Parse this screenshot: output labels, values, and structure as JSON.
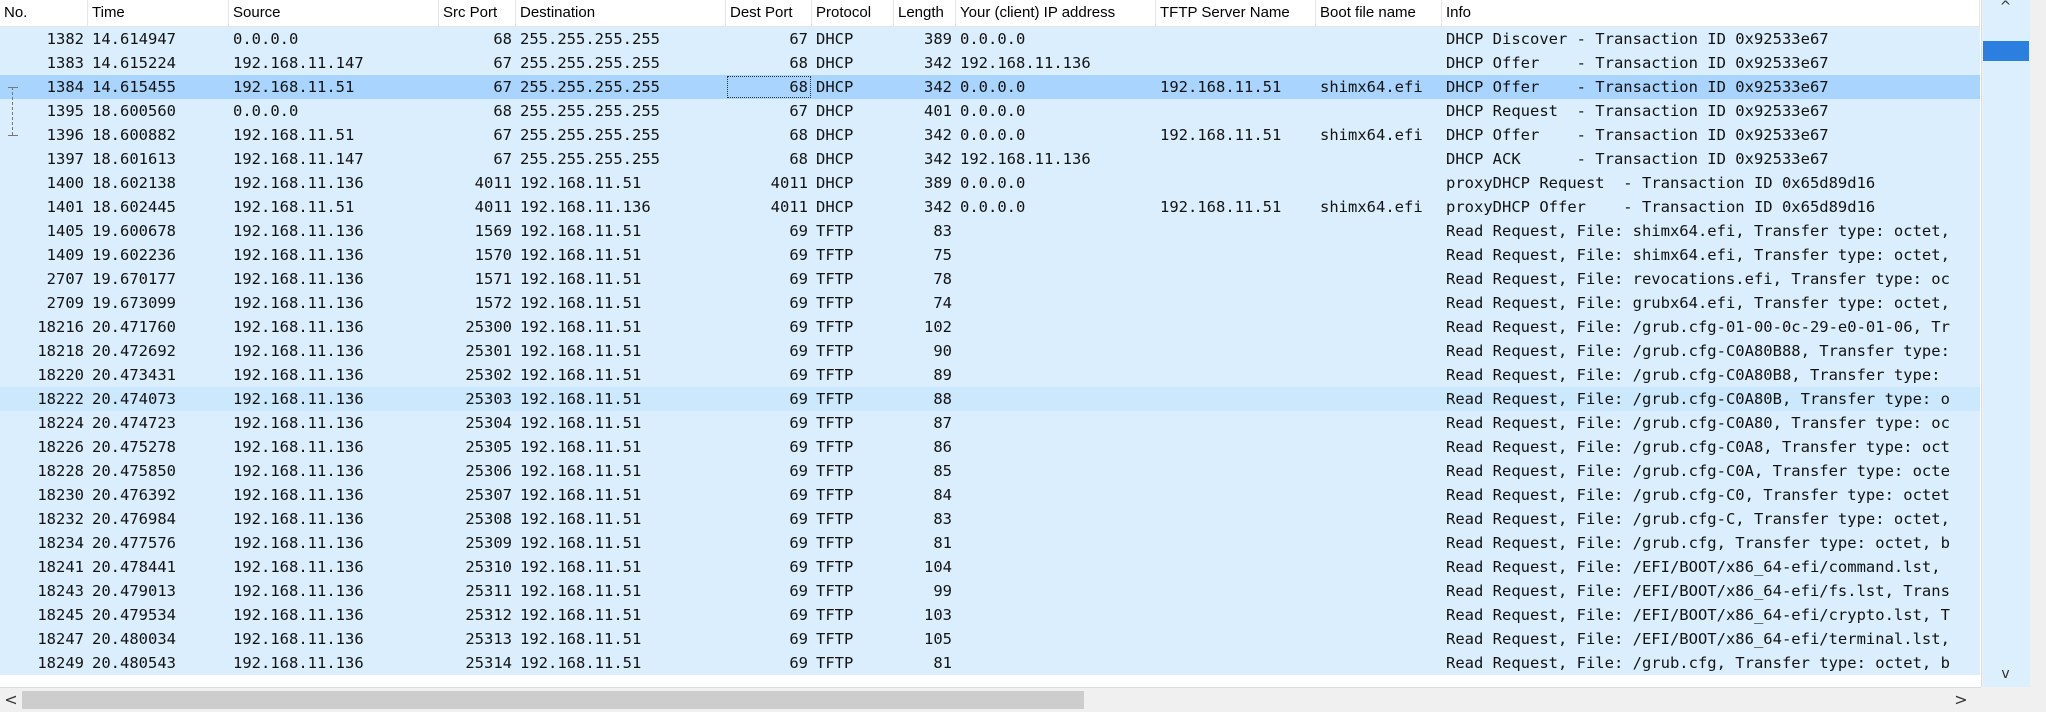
{
  "columns": [
    {
      "key": "no",
      "label": "No."
    },
    {
      "key": "time",
      "label": "Time"
    },
    {
      "key": "source",
      "label": "Source"
    },
    {
      "key": "src_port",
      "label": "Src Port"
    },
    {
      "key": "destination",
      "label": "Destination"
    },
    {
      "key": "dest_port",
      "label": "Dest Port"
    },
    {
      "key": "protocol",
      "label": "Protocol"
    },
    {
      "key": "length",
      "label": "Length"
    },
    {
      "key": "client_ip",
      "label": "Your (client) IP address"
    },
    {
      "key": "tftp_server",
      "label": "TFTP Server Name"
    },
    {
      "key": "boot_file",
      "label": "Boot file name"
    },
    {
      "key": "info",
      "label": "Info"
    }
  ],
  "packets": [
    {
      "no": "1382",
      "time": "14.614947",
      "source": "0.0.0.0",
      "src_port": "68",
      "destination": "255.255.255.255",
      "dest_port": "67",
      "protocol": "DHCP",
      "length": "389",
      "client_ip": "0.0.0.0",
      "tftp_server": "",
      "boot_file": "",
      "info": "DHCP Discover - Transaction ID 0x92533e67"
    },
    {
      "no": "1383",
      "time": "14.615224",
      "source": "192.168.11.147",
      "src_port": "67",
      "destination": "255.255.255.255",
      "dest_port": "68",
      "protocol": "DHCP",
      "length": "342",
      "client_ip": "192.168.11.136",
      "tftp_server": "",
      "boot_file": "",
      "info": "DHCP Offer    - Transaction ID 0x92533e67"
    },
    {
      "no": "1384",
      "time": "14.615455",
      "source": "192.168.11.51",
      "src_port": "67",
      "destination": "255.255.255.255",
      "dest_port": "68",
      "protocol": "DHCP",
      "length": "342",
      "client_ip": "0.0.0.0",
      "tftp_server": "192.168.11.51",
      "boot_file": "shimx64.efi",
      "info": "DHCP Offer    - Transaction ID 0x92533e67"
    },
    {
      "no": "1395",
      "time": "18.600560",
      "source": "0.0.0.0",
      "src_port": "68",
      "destination": "255.255.255.255",
      "dest_port": "67",
      "protocol": "DHCP",
      "length": "401",
      "client_ip": "0.0.0.0",
      "tftp_server": "",
      "boot_file": "",
      "info": "DHCP Request  - Transaction ID 0x92533e67"
    },
    {
      "no": "1396",
      "time": "18.600882",
      "source": "192.168.11.51",
      "src_port": "67",
      "destination": "255.255.255.255",
      "dest_port": "68",
      "protocol": "DHCP",
      "length": "342",
      "client_ip": "0.0.0.0",
      "tftp_server": "192.168.11.51",
      "boot_file": "shimx64.efi",
      "info": "DHCP Offer    - Transaction ID 0x92533e67"
    },
    {
      "no": "1397",
      "time": "18.601613",
      "source": "192.168.11.147",
      "src_port": "67",
      "destination": "255.255.255.255",
      "dest_port": "68",
      "protocol": "DHCP",
      "length": "342",
      "client_ip": "192.168.11.136",
      "tftp_server": "",
      "boot_file": "",
      "info": "DHCP ACK      - Transaction ID 0x92533e67"
    },
    {
      "no": "1400",
      "time": "18.602138",
      "source": "192.168.11.136",
      "src_port": "4011",
      "destination": "192.168.11.51",
      "dest_port": "4011",
      "protocol": "DHCP",
      "length": "389",
      "client_ip": "0.0.0.0",
      "tftp_server": "",
      "boot_file": "",
      "info": "proxyDHCP Request  - Transaction ID 0x65d89d16"
    },
    {
      "no": "1401",
      "time": "18.602445",
      "source": "192.168.11.51",
      "src_port": "4011",
      "destination": "192.168.11.136",
      "dest_port": "4011",
      "protocol": "DHCP",
      "length": "342",
      "client_ip": "0.0.0.0",
      "tftp_server": "192.168.11.51",
      "boot_file": "shimx64.efi",
      "info": "proxyDHCP Offer    - Transaction ID 0x65d89d16"
    },
    {
      "no": "1405",
      "time": "19.600678",
      "source": "192.168.11.136",
      "src_port": "1569",
      "destination": "192.168.11.51",
      "dest_port": "69",
      "protocol": "TFTP",
      "length": "83",
      "client_ip": "",
      "tftp_server": "",
      "boot_file": "",
      "info": "Read Request, File: shimx64.efi, Transfer type: octet,"
    },
    {
      "no": "1409",
      "time": "19.602236",
      "source": "192.168.11.136",
      "src_port": "1570",
      "destination": "192.168.11.51",
      "dest_port": "69",
      "protocol": "TFTP",
      "length": "75",
      "client_ip": "",
      "tftp_server": "",
      "boot_file": "",
      "info": "Read Request, File: shimx64.efi, Transfer type: octet,"
    },
    {
      "no": "2707",
      "time": "19.670177",
      "source": "192.168.11.136",
      "src_port": "1571",
      "destination": "192.168.11.51",
      "dest_port": "69",
      "protocol": "TFTP",
      "length": "78",
      "client_ip": "",
      "tftp_server": "",
      "boot_file": "",
      "info": "Read Request, File: revocations.efi, Transfer type: oc"
    },
    {
      "no": "2709",
      "time": "19.673099",
      "source": "192.168.11.136",
      "src_port": "1572",
      "destination": "192.168.11.51",
      "dest_port": "69",
      "protocol": "TFTP",
      "length": "74",
      "client_ip": "",
      "tftp_server": "",
      "boot_file": "",
      "info": "Read Request, File: grubx64.efi, Transfer type: octet,"
    },
    {
      "no": "18216",
      "time": "20.471760",
      "source": "192.168.11.136",
      "src_port": "25300",
      "destination": "192.168.11.51",
      "dest_port": "69",
      "protocol": "TFTP",
      "length": "102",
      "client_ip": "",
      "tftp_server": "",
      "boot_file": "",
      "info": "Read Request, File: /grub.cfg-01-00-0c-29-e0-01-06, Tr"
    },
    {
      "no": "18218",
      "time": "20.472692",
      "source": "192.168.11.136",
      "src_port": "25301",
      "destination": "192.168.11.51",
      "dest_port": "69",
      "protocol": "TFTP",
      "length": "90",
      "client_ip": "",
      "tftp_server": "",
      "boot_file": "",
      "info": "Read Request, File: /grub.cfg-C0A80B88, Transfer type:"
    },
    {
      "no": "18220",
      "time": "20.473431",
      "source": "192.168.11.136",
      "src_port": "25302",
      "destination": "192.168.11.51",
      "dest_port": "69",
      "protocol": "TFTP",
      "length": "89",
      "client_ip": "",
      "tftp_server": "",
      "boot_file": "",
      "info": "Read Request, File: /grub.cfg-C0A80B8, Transfer type:"
    },
    {
      "no": "18222",
      "time": "20.474073",
      "source": "192.168.11.136",
      "src_port": "25303",
      "destination": "192.168.11.51",
      "dest_port": "69",
      "protocol": "TFTP",
      "length": "88",
      "client_ip": "",
      "tftp_server": "",
      "boot_file": "",
      "info": "Read Request, File: /grub.cfg-C0A80B, Transfer type: o"
    },
    {
      "no": "18224",
      "time": "20.474723",
      "source": "192.168.11.136",
      "src_port": "25304",
      "destination": "192.168.11.51",
      "dest_port": "69",
      "protocol": "TFTP",
      "length": "87",
      "client_ip": "",
      "tftp_server": "",
      "boot_file": "",
      "info": "Read Request, File: /grub.cfg-C0A80, Transfer type: oc"
    },
    {
      "no": "18226",
      "time": "20.475278",
      "source": "192.168.11.136",
      "src_port": "25305",
      "destination": "192.168.11.51",
      "dest_port": "69",
      "protocol": "TFTP",
      "length": "86",
      "client_ip": "",
      "tftp_server": "",
      "boot_file": "",
      "info": "Read Request, File: /grub.cfg-C0A8, Transfer type: oct"
    },
    {
      "no": "18228",
      "time": "20.475850",
      "source": "192.168.11.136",
      "src_port": "25306",
      "destination": "192.168.11.51",
      "dest_port": "69",
      "protocol": "TFTP",
      "length": "85",
      "client_ip": "",
      "tftp_server": "",
      "boot_file": "",
      "info": "Read Request, File: /grub.cfg-C0A, Transfer type: octe"
    },
    {
      "no": "18230",
      "time": "20.476392",
      "source": "192.168.11.136",
      "src_port": "25307",
      "destination": "192.168.11.51",
      "dest_port": "69",
      "protocol": "TFTP",
      "length": "84",
      "client_ip": "",
      "tftp_server": "",
      "boot_file": "",
      "info": "Read Request, File: /grub.cfg-C0, Transfer type: octet"
    },
    {
      "no": "18232",
      "time": "20.476984",
      "source": "192.168.11.136",
      "src_port": "25308",
      "destination": "192.168.11.51",
      "dest_port": "69",
      "protocol": "TFTP",
      "length": "83",
      "client_ip": "",
      "tftp_server": "",
      "boot_file": "",
      "info": "Read Request, File: /grub.cfg-C, Transfer type: octet,"
    },
    {
      "no": "18234",
      "time": "20.477576",
      "source": "192.168.11.136",
      "src_port": "25309",
      "destination": "192.168.11.51",
      "dest_port": "69",
      "protocol": "TFTP",
      "length": "81",
      "client_ip": "",
      "tftp_server": "",
      "boot_file": "",
      "info": "Read Request, File: /grub.cfg, Transfer type: octet, b"
    },
    {
      "no": "18241",
      "time": "20.478441",
      "source": "192.168.11.136",
      "src_port": "25310",
      "destination": "192.168.11.51",
      "dest_port": "69",
      "protocol": "TFTP",
      "length": "104",
      "client_ip": "",
      "tftp_server": "",
      "boot_file": "",
      "info": "Read Request, File: /EFI/BOOT/x86_64-efi/command.lst,"
    },
    {
      "no": "18243",
      "time": "20.479013",
      "source": "192.168.11.136",
      "src_port": "25311",
      "destination": "192.168.11.51",
      "dest_port": "69",
      "protocol": "TFTP",
      "length": "99",
      "client_ip": "",
      "tftp_server": "",
      "boot_file": "",
      "info": "Read Request, File: /EFI/BOOT/x86_64-efi/fs.lst, Trans"
    },
    {
      "no": "18245",
      "time": "20.479534",
      "source": "192.168.11.136",
      "src_port": "25312",
      "destination": "192.168.11.51",
      "dest_port": "69",
      "protocol": "TFTP",
      "length": "103",
      "client_ip": "",
      "tftp_server": "",
      "boot_file": "",
      "info": "Read Request, File: /EFI/BOOT/x86_64-efi/crypto.lst, T"
    },
    {
      "no": "18247",
      "time": "20.480034",
      "source": "192.168.11.136",
      "src_port": "25313",
      "destination": "192.168.11.51",
      "dest_port": "69",
      "protocol": "TFTP",
      "length": "105",
      "client_ip": "",
      "tftp_server": "",
      "boot_file": "",
      "info": "Read Request, File: /EFI/BOOT/x86_64-efi/terminal.lst,"
    },
    {
      "no": "18249",
      "time": "20.480543",
      "source": "192.168.11.136",
      "src_port": "25314",
      "destination": "192.168.11.51",
      "dest_port": "69",
      "protocol": "TFTP",
      "length": "81",
      "client_ip": "",
      "tftp_server": "",
      "boot_file": "",
      "info": "Read Request, File: /grub.cfg, Transfer type: octet, b"
    }
  ],
  "selected_packet": "1384",
  "highlighted_packet": "18222",
  "scroll": {
    "left_arrow": "<",
    "right_arrow": ">",
    "up_arrow": "^",
    "down_arrow": "v"
  },
  "colors": {
    "row_bg": "#daeefe",
    "selected_bg": "#a8d4fd",
    "marker": "#2b7fde"
  }
}
